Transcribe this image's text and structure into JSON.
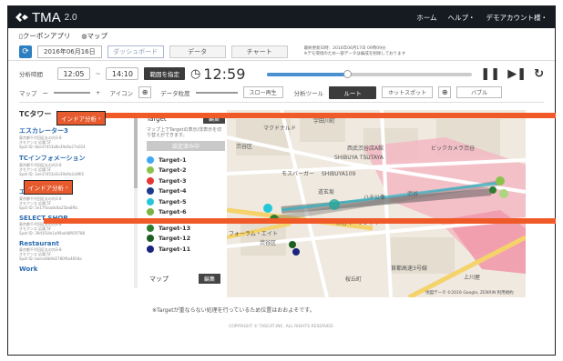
{
  "header": {
    "logo": "TMA",
    "version": "2.0",
    "nav": [
      "ホーム",
      "ヘルプ・",
      "デモアカウント様・"
    ]
  },
  "subnav": {
    "coupon": "クーポンアプリ",
    "map": "マップ"
  },
  "toolbar": {
    "refresh_icon": "refresh-icon",
    "date": "2016年06月16日",
    "tabs": [
      "ダッシュボード",
      "データ",
      "チャート"
    ],
    "note_line1": "最終更新日時：2016年06月17日 09時09分",
    "note_line2": "※デモ環境のため一部データは編成を削除しております"
  },
  "controls": {
    "period_label": "分析時間",
    "start": "12:05",
    "tilde": "~",
    "end": "14:10",
    "range_button": "範囲を指定",
    "current_time": "12:59",
    "progress": 0.39
  },
  "tools": {
    "map_label": "マップ",
    "minus": "ー",
    "plus": "+",
    "icon_label": "アイコン",
    "data_precision_label": "データ粒度",
    "slow_play": "スロー再生",
    "analysis_tool_label": "分析ツール",
    "route": "ルート",
    "hotspot": "ホットスポット",
    "bubble": "バブル"
  },
  "left": {
    "title": "TCタワー",
    "badge1": "インドア分析",
    "badge2": "インドア分析",
    "shops": [
      {
        "name": "エスカレーター3",
        "addr1": "東京都千代田区丸の内3-8",
        "addr2": "オモアンス 広場 5F",
        "addr3": "Spot ID: 8ee37453a8e39a9a27e024"
      },
      {
        "name": "TCインフォメーション",
        "addr1": "東京都千代田区丸の内3-8",
        "addr2": "オモアンス 広場 5F",
        "addr3": "Spot ID: 1ee37453a5e39a9a2c89f2"
      },
      {
        "name": "エレベーター1",
        "addr1": "東京都千代田区丸の内3-8",
        "addr2": "オモアンス 広場 5F",
        "addr3": "Spot ID: 5e17f3aa8c8a25be8f6c"
      },
      {
        "name": "SELECT SHOP",
        "addr1": "東京都千代田区丸の内3-8",
        "addr2": "オモアンス 広場 5F",
        "addr3": "Spot ID: 39d1f34e1a99ad48f05f788"
      },
      {
        "name": "Restaurant",
        "addr1": "東京都千代田区丸の内3-8",
        "addr2": "オモアンス 広場 5F",
        "addr3": "Spot ID: baeca6b9d2780f4e4604a"
      },
      {
        "name": "Work",
        "addr1": "",
        "addr2": "",
        "addr3": ""
      }
    ]
  },
  "targets": {
    "title": "Target",
    "edit": "編集",
    "desc": "マップ上でTargetの表示/非表示を切り替えができます。",
    "set_label": "設定済み中",
    "items": [
      {
        "name": "Target-1",
        "color": "#3fa9f5"
      },
      {
        "name": "Target-2",
        "color": "#8bc34a"
      },
      {
        "name": "Target-3",
        "color": "#e53935"
      },
      {
        "name": "Target-4",
        "color": "#1e3a8a"
      },
      {
        "name": "Target-5",
        "color": "#26c6da"
      },
      {
        "name": "Target-6",
        "color": "#7cb342"
      },
      {
        "name": "Target-13",
        "color": "#2e7d32"
      },
      {
        "name": "Target-12",
        "color": "#1b5e20"
      },
      {
        "name": "Target-11",
        "color": "#1a237e"
      }
    ],
    "map_label": "マップ",
    "map_edit": "編集"
  },
  "map_labels": {
    "l1": "マクドナルド",
    "l2": "宇田川町",
    "l3": "渋谷区",
    "l4": "西武渋谷店A館",
    "l5": "SHIBUYA TSUTAYA",
    "l6": "ビックカメラ渋谷",
    "l7": "モスバーガー",
    "l8": "SHIBUYA109",
    "l9": "道玄坂",
    "l10": "渋谷",
    "l11": "ハチ公像",
    "l12": "フォーラム・エイト",
    "l13": "渋谷区",
    "l14": "首都高速3号線",
    "l15": "渋谷マークシティ",
    "l16": "上川屋",
    "l17": "桜丘町",
    "attribution": "地図データ ©2016 Google, ZENRIN 利用規約"
  },
  "footer": {
    "note": "※Targetが重ならない処理を行っているため位置はおおよそです。",
    "copyright": "COPYRIGHT © TASCAT,INC. ALL RIGHTS RESERVED."
  }
}
